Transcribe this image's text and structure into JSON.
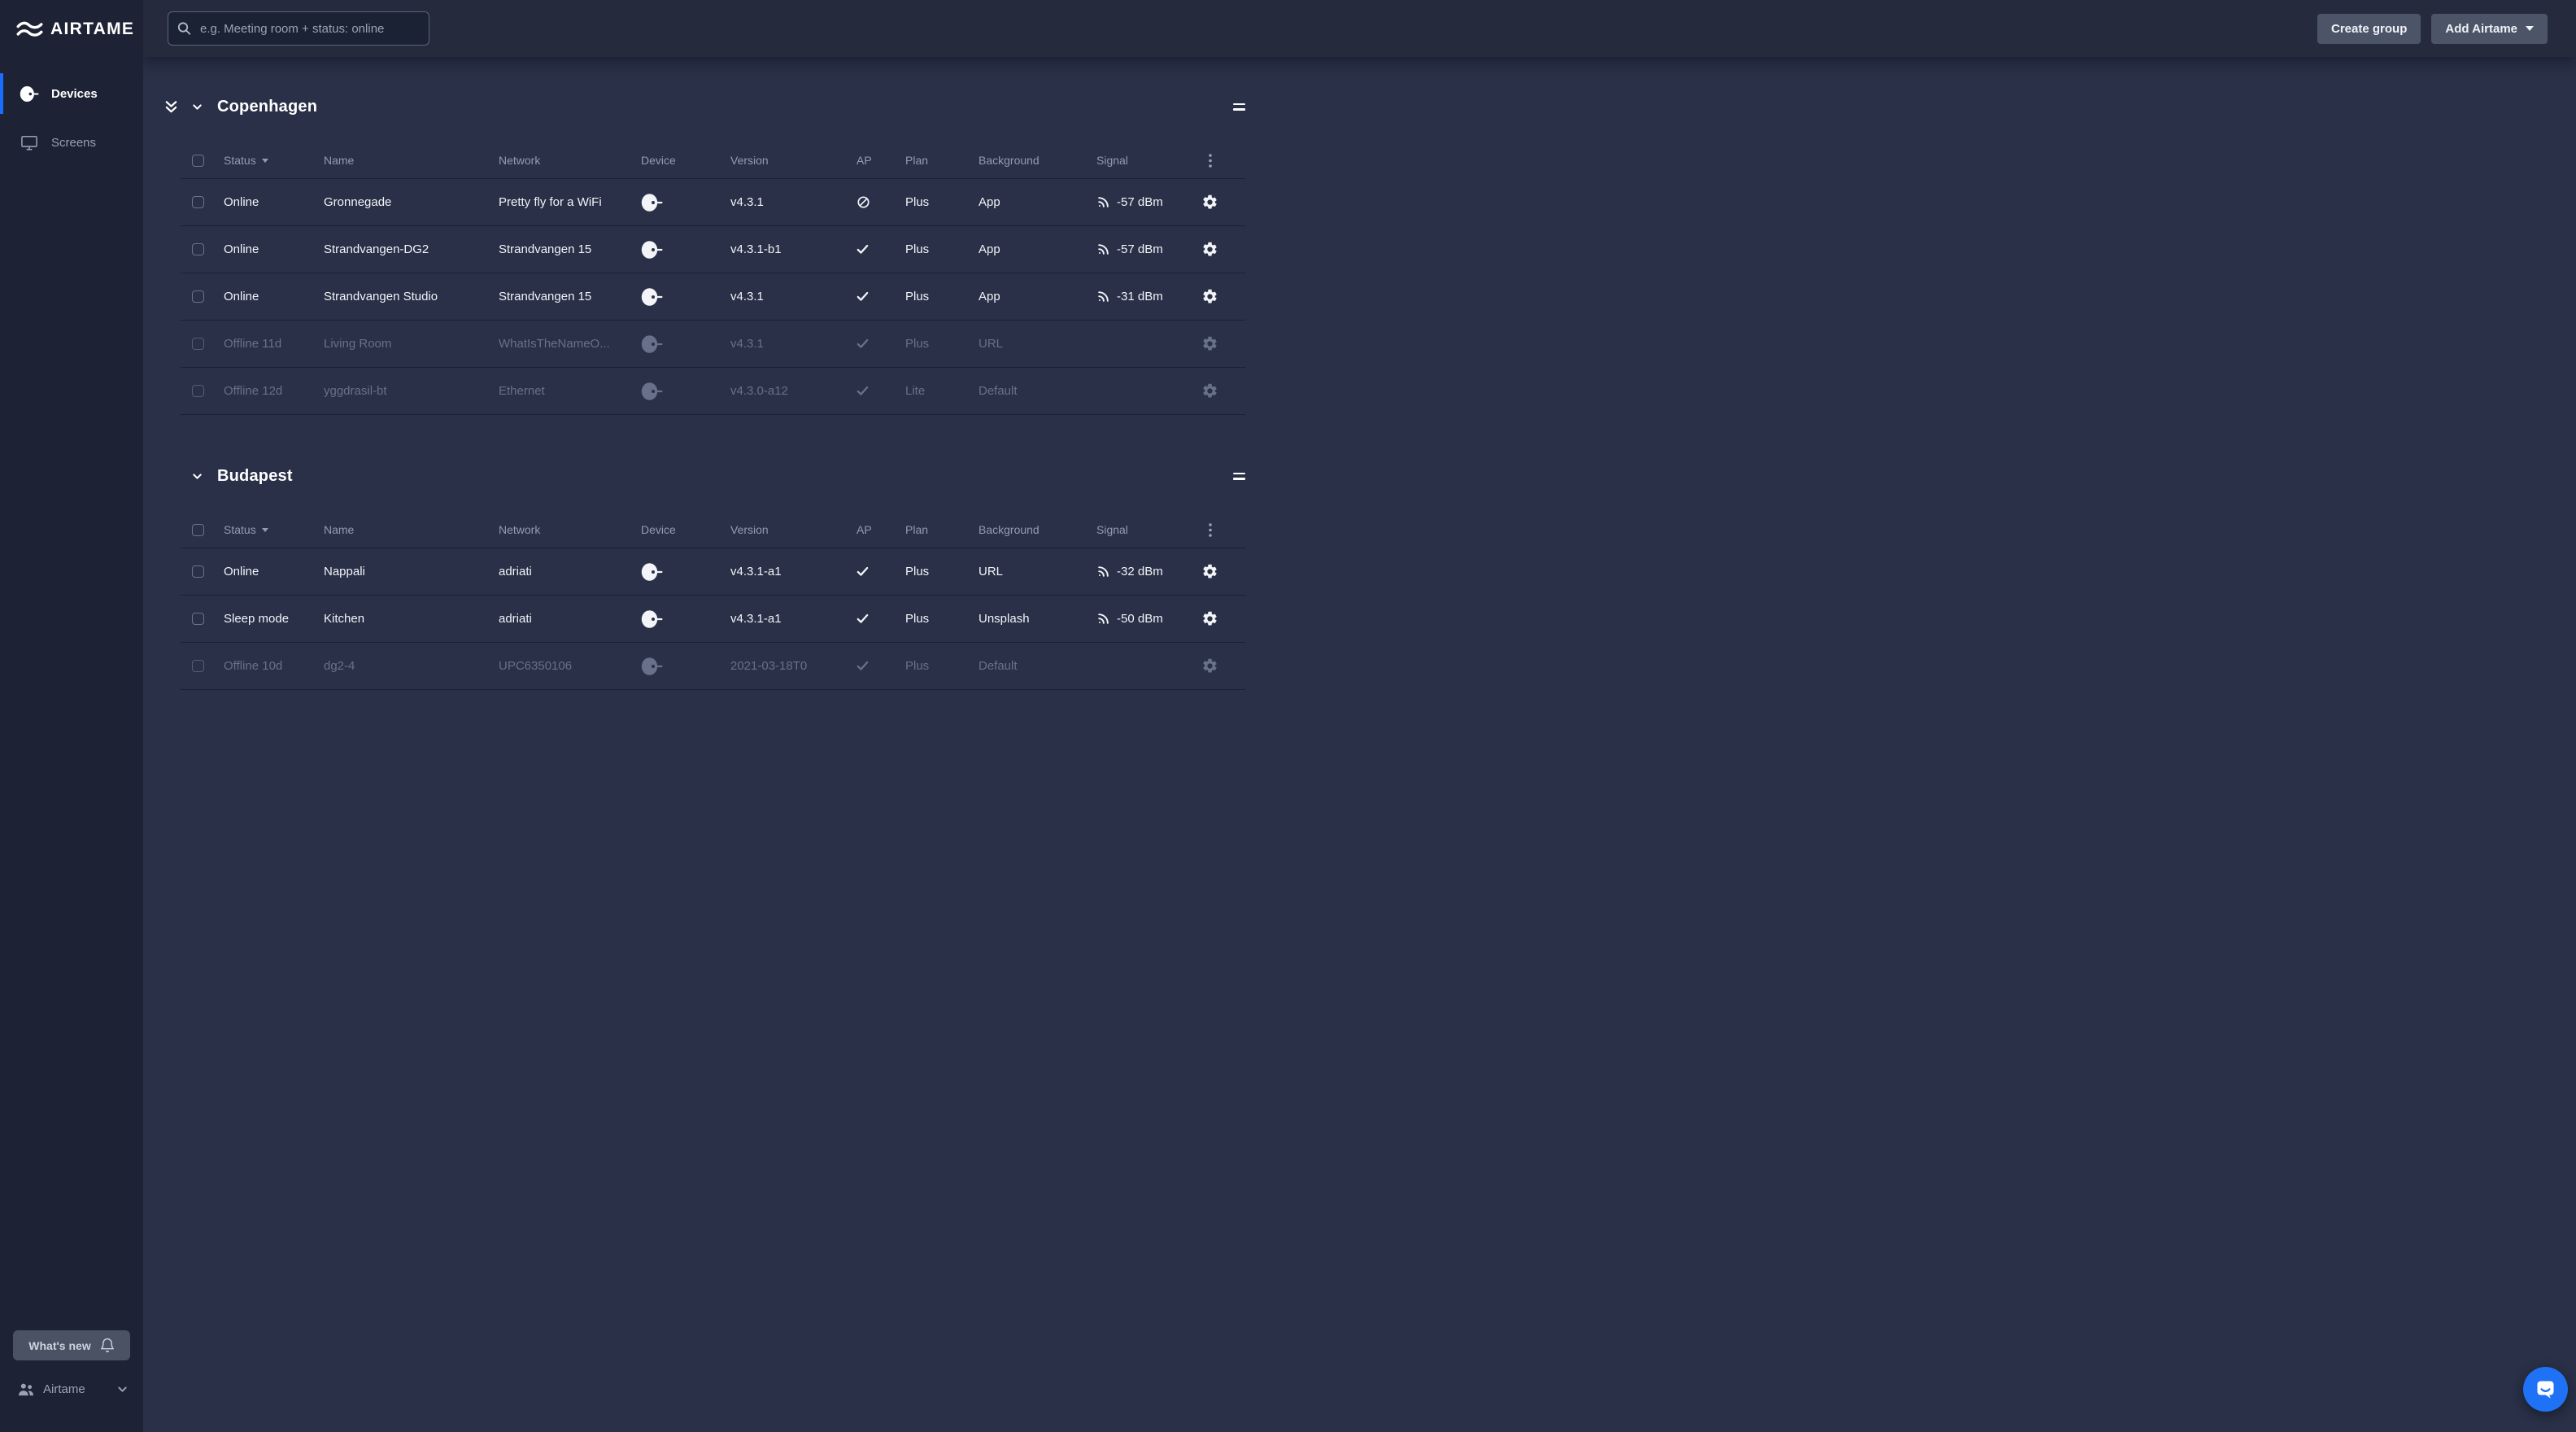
{
  "brand": {
    "logo_text": "AIRTAME",
    "logo_icon": "airtame-wave-icon"
  },
  "sidebar": {
    "nav": [
      {
        "label": "Devices",
        "icon": "device-icon",
        "active": true
      },
      {
        "label": "Screens",
        "icon": "screens-icon",
        "active": false
      }
    ],
    "whats_new_label": "What's new",
    "whats_new_icon": "bell-icon",
    "org": {
      "label": "Airtame",
      "icon": "people-icon",
      "chevron": "chevron-down-icon"
    }
  },
  "topbar": {
    "search_placeholder": "e.g. Meeting room + status: online",
    "search_icon": "search-icon",
    "create_group_label": "Create group",
    "add_airtame_label": "Add Airtame"
  },
  "table": {
    "columns": [
      "Status",
      "Name",
      "Network",
      "Device",
      "Version",
      "AP",
      "Plan",
      "Background",
      "Signal"
    ],
    "sorted_column": "Status"
  },
  "groups": [
    {
      "name": "Copenhagen",
      "has_collapse_all": true,
      "rows": [
        {
          "status": "Online",
          "name": "Gronnegade",
          "network": "Pretty fly for a WiFi",
          "version": "v4.3.1",
          "ap": "blocked",
          "plan": "Plus",
          "background": "App",
          "signal": "-57 dBm",
          "offline": false
        },
        {
          "status": "Online",
          "name": "Strandvangen-DG2",
          "network": "Strandvangen 15",
          "version": "v4.3.1-b1",
          "ap": "check",
          "plan": "Plus",
          "background": "App",
          "signal": "-57 dBm",
          "offline": false
        },
        {
          "status": "Online",
          "name": "Strandvangen Studio",
          "network": "Strandvangen 15",
          "version": "v4.3.1",
          "ap": "check",
          "plan": "Plus",
          "background": "App",
          "signal": "-31 dBm",
          "offline": false
        },
        {
          "status": "Offline 11d",
          "name": "Living Room",
          "network": "WhatIsTheNameO...",
          "version": "v4.3.1",
          "ap": "check",
          "plan": "Plus",
          "background": "URL",
          "signal": "",
          "offline": true
        },
        {
          "status": "Offline 12d",
          "name": "yggdrasil-bt",
          "network": "Ethernet",
          "version": "v4.3.0-a12",
          "ap": "check",
          "plan": "Lite",
          "background": "Default",
          "signal": "",
          "offline": true
        }
      ]
    },
    {
      "name": "Budapest",
      "has_collapse_all": false,
      "rows": [
        {
          "status": "Online",
          "name": "Nappali",
          "network": "adriati",
          "version": "v4.3.1-a1",
          "ap": "check",
          "plan": "Plus",
          "background": "URL",
          "signal": "-32 dBm",
          "offline": false
        },
        {
          "status": "Sleep mode",
          "name": "Kitchen",
          "network": "adriati",
          "version": "v4.3.1-a1",
          "ap": "check",
          "plan": "Plus",
          "background": "Unsplash",
          "signal": "-50 dBm",
          "offline": false
        },
        {
          "status": "Offline 10d",
          "name": "dg2-4",
          "network": "UPC6350106",
          "version": "2021-03-18T0",
          "ap": "check",
          "plan": "Plus",
          "background": "Default",
          "signal": "",
          "offline": true
        }
      ]
    }
  ],
  "colors": {
    "accent_blue": "#1a6dff",
    "intercom_blue": "#1f72f5",
    "sidebar_bg": "#1d2334",
    "topbar_bg": "#252b3d",
    "content_bg": "#293047",
    "online_text": "#ffffff",
    "offline_text": "#68718a"
  }
}
